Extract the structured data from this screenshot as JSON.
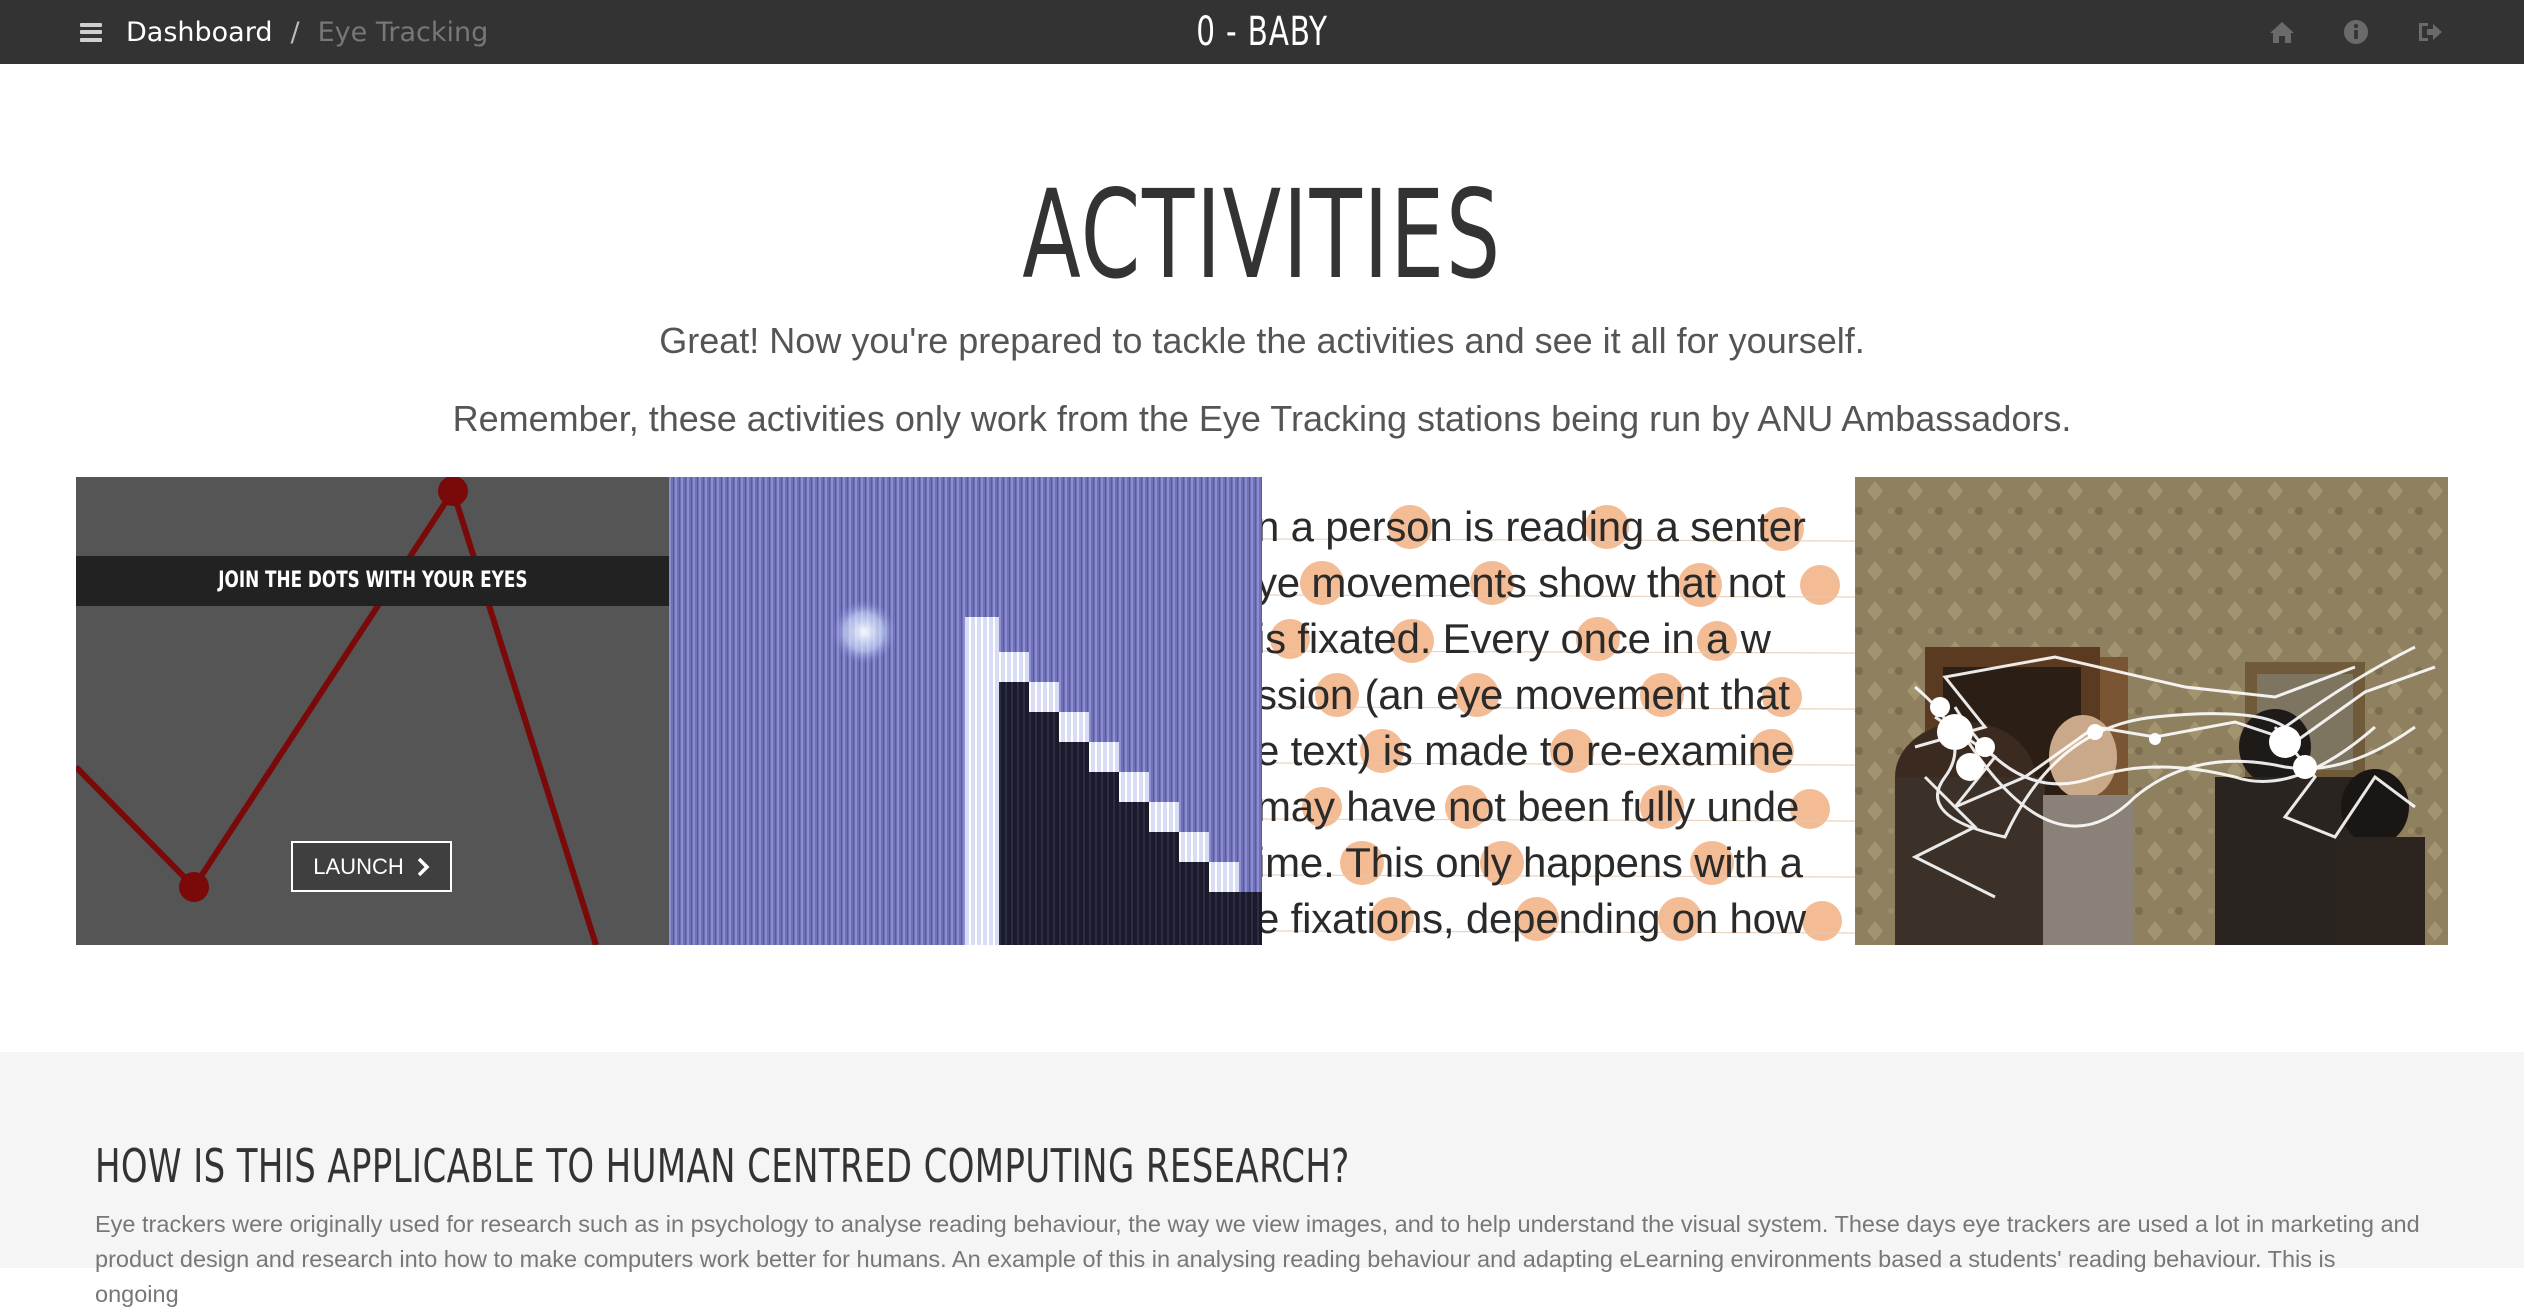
{
  "navbar": {
    "breadcrumb": {
      "home": "Dashboard",
      "separator": "/",
      "current": "Eye Tracking"
    },
    "brand": "0 - BABY",
    "icons": [
      "home-icon",
      "info-icon",
      "sign-out-icon"
    ]
  },
  "hero": {
    "title": "ACTIVITIES",
    "subtitle_1": "Great! Now you're prepared to tackle the activities and see it all for yourself.",
    "subtitle_2": "Remember, these activities only work from the Eye Tracking stations being run by ANU Ambassadors."
  },
  "tiles": [
    {
      "caption": "JOIN THE DOTS WITH YOUR EYES",
      "button": "LAUNCH"
    },
    {},
    {
      "lines": [
        "n a person is reading a senter",
        "ye movements show that not",
        " is fixated.  Every once in a w",
        "ssion (an eye movement that",
        "e text) is made to re-examine",
        "may have not been fully unde",
        "ime. This only happens with a",
        "e fixations, depending on how"
      ]
    },
    {}
  ],
  "info": {
    "title": "HOW IS THIS APPLICABLE TO HUMAN CENTRED COMPUTING RESEARCH?",
    "body": "Eye trackers were originally used for research such as in psychology to analyse reading behaviour, the way we view images, and to help understand the visual system. These days eye trackers are used a lot in marketing and product design and research into how to make computers work better for humans. An example of this in analysing reading behaviour and adapting eLearning environments based a students' reading behaviour. This is ongoing"
  },
  "colors": {
    "navbar_bg": "#333333",
    "accent_red": "#8b0a0a",
    "section_bg": "#f5f5f5"
  }
}
